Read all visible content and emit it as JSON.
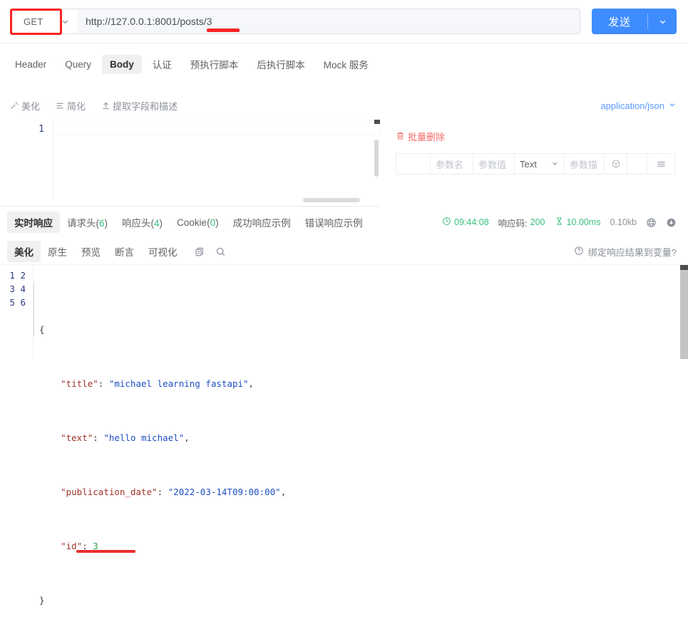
{
  "request": {
    "method": "GET",
    "url": "http://127.0.0.1:8001/posts/3",
    "send_label": "发送",
    "tabs": [
      {
        "label": "Header",
        "active": false
      },
      {
        "label": "Query",
        "active": false
      },
      {
        "label": "Body",
        "active": true
      },
      {
        "label": "认证",
        "active": false
      },
      {
        "label": "预执行脚本",
        "active": false
      },
      {
        "label": "后执行脚本",
        "active": false
      },
      {
        "label": "Mock 服务",
        "active": false
      }
    ],
    "body_toolbar": [
      {
        "label": "美化",
        "icon": "wand-icon"
      },
      {
        "label": "简化",
        "icon": "lines-icon"
      },
      {
        "label": "提取字段和描述",
        "icon": "upload-icon"
      }
    ],
    "content_type": "application/json",
    "editor_line_number": "1",
    "editor_value": ""
  },
  "params": {
    "bulk_delete_label": "批量删除",
    "headers": [
      "",
      "参数名",
      "参数值",
      "Text",
      "参数描",
      "",
      "",
      ""
    ],
    "row": {
      "name_placeholder": "参数名",
      "value_placeholder": "参数值",
      "type_value": "Text",
      "desc_placeholder": "参数描"
    }
  },
  "response": {
    "tabs": [
      {
        "label": "实时响应",
        "count": "",
        "active": true
      },
      {
        "label": "请求头",
        "count": "6",
        "active": false
      },
      {
        "label": "响应头",
        "count": "4",
        "active": false
      },
      {
        "label": "Cookie",
        "count": "0",
        "active": false
      },
      {
        "label": "成功响应示例",
        "count": "",
        "active": false
      },
      {
        "label": "错误响应示例",
        "count": "",
        "active": false
      }
    ],
    "stats": {
      "time": "09:44:08",
      "code_label": "响应码:",
      "code_value": "200",
      "duration": "10.00ms",
      "size": "0.10kb"
    },
    "view_tabs": [
      {
        "label": "美化",
        "active": true
      },
      {
        "label": "原生",
        "active": false
      },
      {
        "label": "预览",
        "active": false
      },
      {
        "label": "断言",
        "active": false
      },
      {
        "label": "可视化",
        "active": false
      }
    ],
    "bind_var_label": "绑定响应结果到变量?",
    "body": {
      "line_numbers": "1\n2\n3\n4\n5\n6",
      "lines": [
        {
          "n": "1",
          "text": "{"
        },
        {
          "n": "2",
          "text": "    \"title\": \"michael learning fastapi\","
        },
        {
          "n": "3",
          "text": "    \"text\": \"hello michael\","
        },
        {
          "n": "4",
          "text": "    \"publication_date\": \"2022-03-14T09:00:00\","
        },
        {
          "n": "5",
          "text": "    \"id\": 3"
        },
        {
          "n": "6",
          "text": "}"
        }
      ],
      "json_object": {
        "title": "michael learning fastapi",
        "text": "hello michael",
        "publication_date": "2022-03-14T09:00:00",
        "id": 3
      },
      "keys": {
        "title": "\"title\"",
        "text": "\"text\"",
        "publication_date": "\"publication_date\"",
        "id": "\"id\""
      },
      "values": {
        "title": "\"michael learning fastapi\"",
        "text": "\"hello michael\"",
        "publication_date": "\"2022-03-14T09:00:00\"",
        "id": "3"
      },
      "brace_open": "{",
      "brace_close": "}"
    }
  },
  "colors": {
    "accent": "#3f8cff",
    "success": "#3ac07e",
    "danger": "#f56c6c",
    "annotation": "#fa2020",
    "json_key": "#a0342c",
    "json_string": "#1e4ec2",
    "json_number": "#2b9e4f"
  }
}
